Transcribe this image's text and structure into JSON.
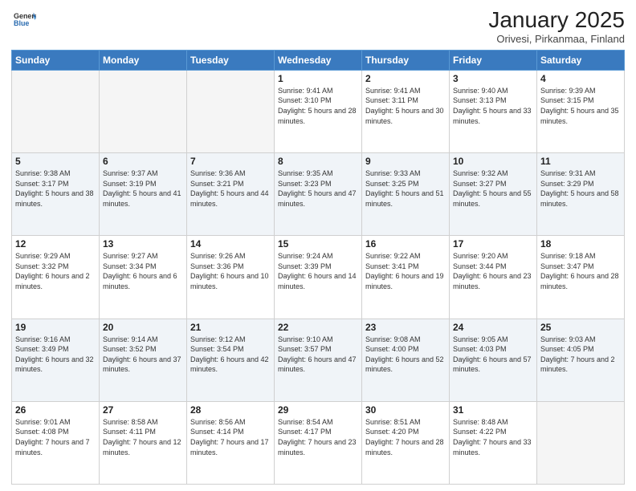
{
  "logo": {
    "general": "General",
    "blue": "Blue"
  },
  "header": {
    "month": "January 2025",
    "location": "Orivesi, Pirkanmaa, Finland"
  },
  "weekdays": [
    "Sunday",
    "Monday",
    "Tuesday",
    "Wednesday",
    "Thursday",
    "Friday",
    "Saturday"
  ],
  "weeks": [
    [
      {
        "day": "",
        "info": ""
      },
      {
        "day": "",
        "info": ""
      },
      {
        "day": "",
        "info": ""
      },
      {
        "day": "1",
        "info": "Sunrise: 9:41 AM\nSunset: 3:10 PM\nDaylight: 5 hours\nand 28 minutes."
      },
      {
        "day": "2",
        "info": "Sunrise: 9:41 AM\nSunset: 3:11 PM\nDaylight: 5 hours\nand 30 minutes."
      },
      {
        "day": "3",
        "info": "Sunrise: 9:40 AM\nSunset: 3:13 PM\nDaylight: 5 hours\nand 33 minutes."
      },
      {
        "day": "4",
        "info": "Sunrise: 9:39 AM\nSunset: 3:15 PM\nDaylight: 5 hours\nand 35 minutes."
      }
    ],
    [
      {
        "day": "5",
        "info": "Sunrise: 9:38 AM\nSunset: 3:17 PM\nDaylight: 5 hours\nand 38 minutes."
      },
      {
        "day": "6",
        "info": "Sunrise: 9:37 AM\nSunset: 3:19 PM\nDaylight: 5 hours\nand 41 minutes."
      },
      {
        "day": "7",
        "info": "Sunrise: 9:36 AM\nSunset: 3:21 PM\nDaylight: 5 hours\nand 44 minutes."
      },
      {
        "day": "8",
        "info": "Sunrise: 9:35 AM\nSunset: 3:23 PM\nDaylight: 5 hours\nand 47 minutes."
      },
      {
        "day": "9",
        "info": "Sunrise: 9:33 AM\nSunset: 3:25 PM\nDaylight: 5 hours\nand 51 minutes."
      },
      {
        "day": "10",
        "info": "Sunrise: 9:32 AM\nSunset: 3:27 PM\nDaylight: 5 hours\nand 55 minutes."
      },
      {
        "day": "11",
        "info": "Sunrise: 9:31 AM\nSunset: 3:29 PM\nDaylight: 5 hours\nand 58 minutes."
      }
    ],
    [
      {
        "day": "12",
        "info": "Sunrise: 9:29 AM\nSunset: 3:32 PM\nDaylight: 6 hours\nand 2 minutes."
      },
      {
        "day": "13",
        "info": "Sunrise: 9:27 AM\nSunset: 3:34 PM\nDaylight: 6 hours\nand 6 minutes."
      },
      {
        "day": "14",
        "info": "Sunrise: 9:26 AM\nSunset: 3:36 PM\nDaylight: 6 hours\nand 10 minutes."
      },
      {
        "day": "15",
        "info": "Sunrise: 9:24 AM\nSunset: 3:39 PM\nDaylight: 6 hours\nand 14 minutes."
      },
      {
        "day": "16",
        "info": "Sunrise: 9:22 AM\nSunset: 3:41 PM\nDaylight: 6 hours\nand 19 minutes."
      },
      {
        "day": "17",
        "info": "Sunrise: 9:20 AM\nSunset: 3:44 PM\nDaylight: 6 hours\nand 23 minutes."
      },
      {
        "day": "18",
        "info": "Sunrise: 9:18 AM\nSunset: 3:47 PM\nDaylight: 6 hours\nand 28 minutes."
      }
    ],
    [
      {
        "day": "19",
        "info": "Sunrise: 9:16 AM\nSunset: 3:49 PM\nDaylight: 6 hours\nand 32 minutes."
      },
      {
        "day": "20",
        "info": "Sunrise: 9:14 AM\nSunset: 3:52 PM\nDaylight: 6 hours\nand 37 minutes."
      },
      {
        "day": "21",
        "info": "Sunrise: 9:12 AM\nSunset: 3:54 PM\nDaylight: 6 hours\nand 42 minutes."
      },
      {
        "day": "22",
        "info": "Sunrise: 9:10 AM\nSunset: 3:57 PM\nDaylight: 6 hours\nand 47 minutes."
      },
      {
        "day": "23",
        "info": "Sunrise: 9:08 AM\nSunset: 4:00 PM\nDaylight: 6 hours\nand 52 minutes."
      },
      {
        "day": "24",
        "info": "Sunrise: 9:05 AM\nSunset: 4:03 PM\nDaylight: 6 hours\nand 57 minutes."
      },
      {
        "day": "25",
        "info": "Sunrise: 9:03 AM\nSunset: 4:05 PM\nDaylight: 7 hours\nand 2 minutes."
      }
    ],
    [
      {
        "day": "26",
        "info": "Sunrise: 9:01 AM\nSunset: 4:08 PM\nDaylight: 7 hours\nand 7 minutes."
      },
      {
        "day": "27",
        "info": "Sunrise: 8:58 AM\nSunset: 4:11 PM\nDaylight: 7 hours\nand 12 minutes."
      },
      {
        "day": "28",
        "info": "Sunrise: 8:56 AM\nSunset: 4:14 PM\nDaylight: 7 hours\nand 17 minutes."
      },
      {
        "day": "29",
        "info": "Sunrise: 8:54 AM\nSunset: 4:17 PM\nDaylight: 7 hours\nand 23 minutes."
      },
      {
        "day": "30",
        "info": "Sunrise: 8:51 AM\nSunset: 4:20 PM\nDaylight: 7 hours\nand 28 minutes."
      },
      {
        "day": "31",
        "info": "Sunrise: 8:48 AM\nSunset: 4:22 PM\nDaylight: 7 hours\nand 33 minutes."
      },
      {
        "day": "",
        "info": ""
      }
    ]
  ]
}
